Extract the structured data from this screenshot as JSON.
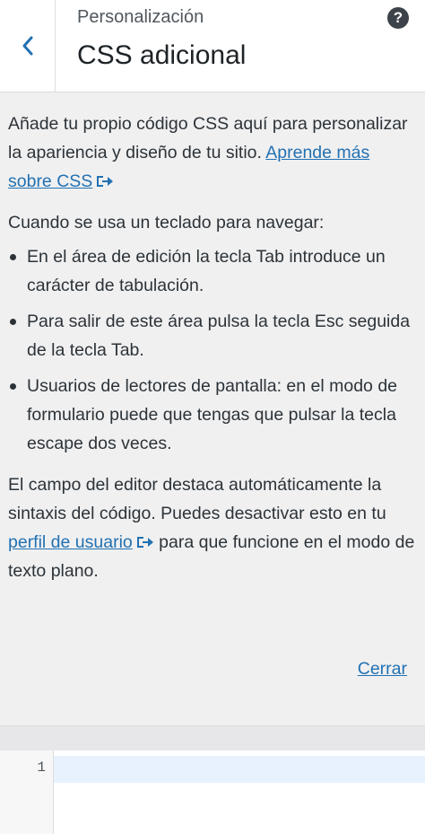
{
  "header": {
    "breadcrumb": "Personalización",
    "title": "CSS adicional",
    "help_label": "?"
  },
  "description": {
    "intro": "Añade tu propio código CSS aquí para personalizar la apariencia y diseño de tu sitio.",
    "learn_more_link": "Aprende más sobre CSS",
    "keyboard_intro": "Cuando se usa un teclado para navegar:",
    "bullets": [
      "En el área de edición la tecla Tab introduce un carácter de tabulación.",
      "Para salir de este área pulsa la tecla Esc seguida de la tecla Tab.",
      "Usuarios de lectores de pantalla: en el modo de formulario puede que tengas que pulsar la tecla escape dos veces."
    ],
    "syntax_text_before": "El campo del editor destaca automáticamente la sintaxis del código. Puedes desactivar esto en tu",
    "profile_link": "perfil de usuario",
    "syntax_text_after": "para que funcione en el modo de texto plano.",
    "close_link": "Cerrar"
  },
  "editor": {
    "line_number": "1"
  },
  "colors": {
    "link": "#2271b1",
    "active_line": "#e8f2ff",
    "panel_bg": "#f0f0f1"
  },
  "icons": {
    "back": "chevron-left-icon",
    "help": "question-circle-icon",
    "external": "external-link-icon"
  }
}
